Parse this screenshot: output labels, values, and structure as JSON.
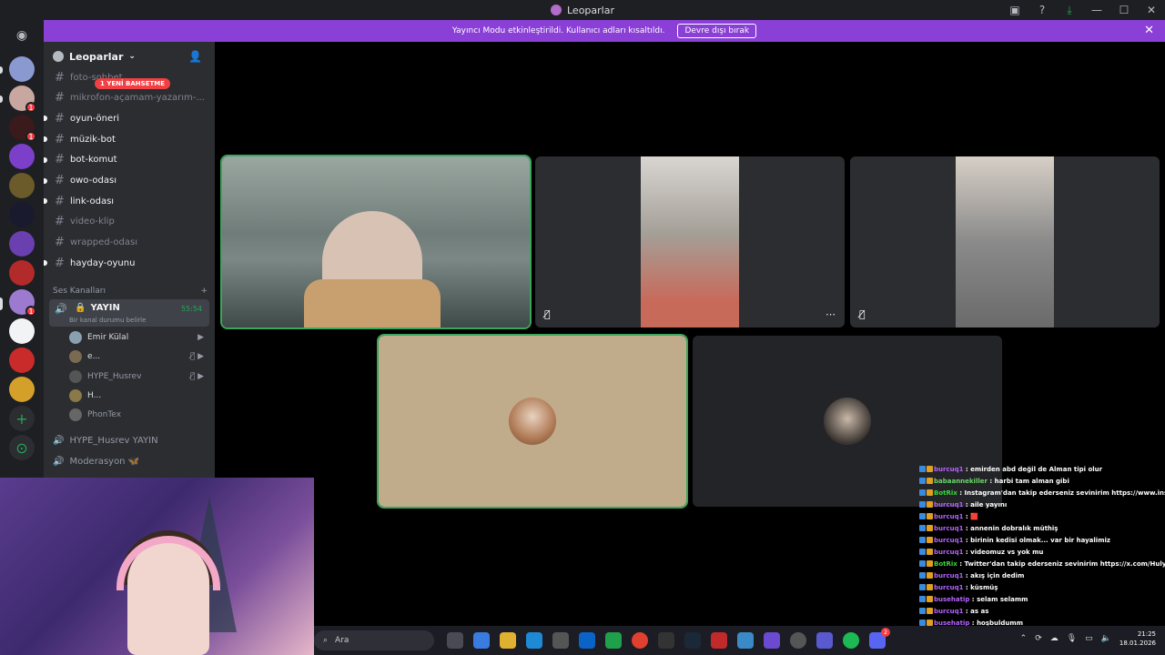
{
  "window": {
    "title": "Leoparlar"
  },
  "banner": {
    "message": "Yayıncı Modu etkinleştirildi. Kullanıcı adları kısaltıldı.",
    "button_label": "Devre dışı bırak"
  },
  "server": {
    "name": "Leoparlar"
  },
  "mention_pill": "1 YENİ BAHSETME",
  "text_channels": [
    {
      "name": "foto-sohbet",
      "unread": false
    },
    {
      "name": "mikrofon-açamam-yazarım-...",
      "unread": false
    },
    {
      "name": "oyun-öneri",
      "unread": true
    },
    {
      "name": "müzik-bot",
      "unread": true
    },
    {
      "name": "bot-komut",
      "unread": true
    },
    {
      "name": "owo-odası",
      "unread": true
    },
    {
      "name": "link-odası",
      "unread": true
    },
    {
      "name": "video-klip",
      "unread": false
    },
    {
      "name": "wrapped-odası",
      "unread": false
    },
    {
      "name": "hayday-oyunu",
      "unread": true
    }
  ],
  "voice_category": "Ses Kanalları",
  "active_voice": {
    "name": "YAYIN",
    "status": "Bir kanal durumu belirle",
    "timer": "55:54"
  },
  "voice_users": [
    {
      "name": "Emir Külal",
      "dim": false
    },
    {
      "name": "e...",
      "dim": false
    },
    {
      "name": "HYPE_Husrev",
      "dim": true
    },
    {
      "name": "H...",
      "dim": false
    },
    {
      "name": "PhonTex",
      "dim": true
    }
  ],
  "other_voice_channels": [
    {
      "name": "HYPE_Husrev YAYIN"
    },
    {
      "name": "Moderasyon 🦋"
    }
  ],
  "chat_lines": [
    {
      "user": "burcuq1",
      "color": "#b464ff",
      "text": "emirden abd değil de Alman tipi olur"
    },
    {
      "user": "babaannekiller",
      "color": "#6ad86a",
      "text": "harbi tam alman gibi"
    },
    {
      "user": "BotRix",
      "color": "#3cd63c",
      "text": "Instagram'dan takip ederseniz sevinirim https://www.instagram.com/hulyayarar/"
    },
    {
      "user": "burcuq1",
      "color": "#b464ff",
      "text": "aile yayını"
    },
    {
      "user": "burcuq1",
      "color": "#b464ff",
      "text": "🟥"
    },
    {
      "user": "burcuq1",
      "color": "#b464ff",
      "text": "annenin dobralık müthiş"
    },
    {
      "user": "burcuq1",
      "color": "#b464ff",
      "text": "birinin kedisi olmak... var bir hayalimiz"
    },
    {
      "user": "burcuq1",
      "color": "#b464ff",
      "text": "videomuz vs yok mu"
    },
    {
      "user": "BotRix",
      "color": "#3cd63c",
      "text": "Twitter'dan takip ederseniz sevinirim https://x.com/Hulya_yarar"
    },
    {
      "user": "burcuq1",
      "color": "#b464ff",
      "text": "akış için dedim"
    },
    {
      "user": "burcuq1",
      "color": "#b464ff",
      "text": "küsmüş"
    },
    {
      "user": "busehatip",
      "color": "#b464ff",
      "text": "selam selamm"
    },
    {
      "user": "burcuq1",
      "color": "#b464ff",
      "text": "as as"
    },
    {
      "user": "busehatip",
      "color": "#b464ff",
      "text": "hoşbuldumm"
    }
  ],
  "taskbar": {
    "search_placeholder": "Ara",
    "time": "21:25",
    "date": "18.01.2026",
    "discord_badge": "2"
  },
  "colors": {
    "banner": "#8a3fd6",
    "speaking": "#3ba55c",
    "sidebar": "#2b2d31",
    "rail": "#1e1f22"
  }
}
